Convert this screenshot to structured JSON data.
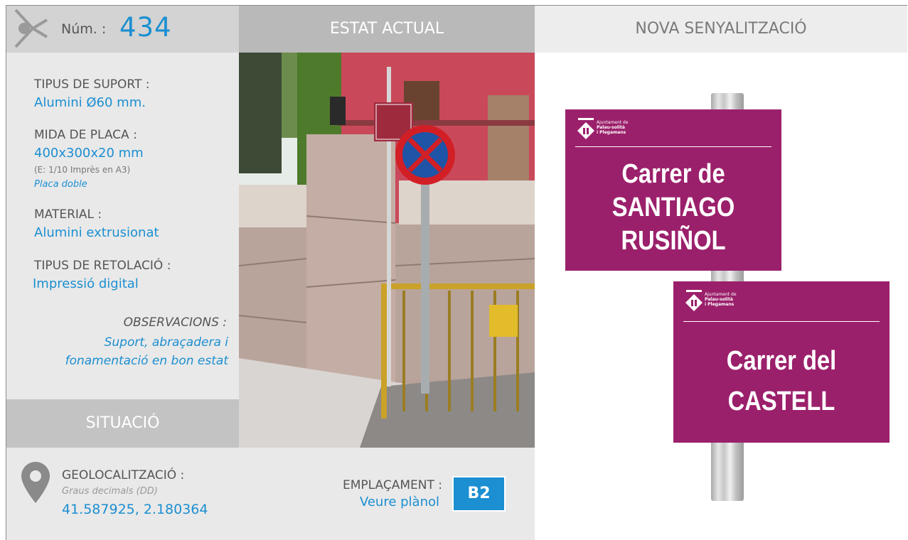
{
  "header": {
    "num_label": "Núm. :",
    "num_value": "434",
    "estat_actual": "ESTAT ACTUAL",
    "nova_senyalitzacio": "NOVA SENYALITZACIÓ"
  },
  "specs": {
    "suport_label": "TIPUS DE SUPORT :",
    "suport_value": "Alumini Ø60 mm.",
    "mida_label": "MIDA DE PLACA :",
    "mida_value": "400x300x20 mm",
    "mida_scale": "(E: 1/10 Imprès en A3)",
    "mida_note": "Placa doble",
    "material_label": "MATERIAL :",
    "material_value": "Alumini extrusionat",
    "retolacio_label": "TIPUS DE RETOLACIÓ :",
    "retolacio_value": "Impressió digital",
    "observacions_label": "OBSERVACIONS :",
    "observacions_value": "Suport, abraçadera i fonamentació en bon estat"
  },
  "situacio": {
    "title": "SITUACIÓ"
  },
  "location": {
    "geo_label": "GEOLOCALITZACIÓ :",
    "geo_sub": "Graus decimals (DD)",
    "geo_value": "41.587925, 2.180364",
    "emplacament_label": "EMPLAÇAMENT :",
    "emplacament_link": "Veure plànol",
    "emplacament_code": "B2"
  },
  "plates": [
    {
      "council_1": "Ajuntament de",
      "council_2": "Palau-solità",
      "council_3": "i Plegamans",
      "line1": "Carrer de",
      "line2": "SANTIAGO",
      "line3": "RUSIÑOL"
    },
    {
      "council_1": "Ajuntament de",
      "council_2": "Palau-solità",
      "council_3": "i Plegamans",
      "line1": "Carrer del",
      "line2": "CASTELL"
    }
  ],
  "colors": {
    "accent": "#1b8fd1",
    "plate": "#9b206b"
  },
  "icons": [
    "share-logo-icon",
    "map-pin-icon",
    "council-crest-icon"
  ]
}
